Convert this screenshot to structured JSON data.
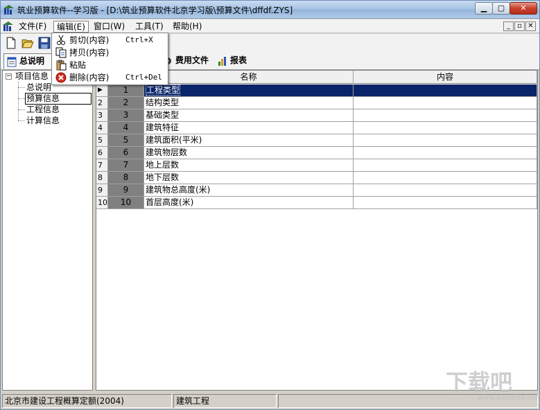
{
  "titlebar": {
    "title": "筑业预算软件--学习版 - [D:\\筑业预算软件北京学习版\\预算文件\\dffdf.ZYS]",
    "minimize_label": "▁",
    "maximize_label": "▢",
    "close_label": "✕"
  },
  "menubar": {
    "items": [
      {
        "label": "文件(F)"
      },
      {
        "label": "编辑(E)"
      },
      {
        "label": "窗口(W)"
      },
      {
        "label": "工具(T)"
      },
      {
        "label": "帮助(H)"
      }
    ],
    "mdi_controls": [
      "_",
      "▫",
      "✕"
    ]
  },
  "edit_menu": {
    "items": [
      {
        "label": "剪切(内容)",
        "shortcut": "Ctrl+X",
        "icon": "scissors-icon"
      },
      {
        "label": "拷贝(内容)",
        "shortcut": "",
        "icon": "copy-icon"
      },
      {
        "label": "粘贴",
        "shortcut": "",
        "icon": "paste-icon"
      },
      {
        "label": "删除(内容)",
        "shortcut": "Ctrl+Del",
        "icon": "delete-icon"
      }
    ]
  },
  "tabs": [
    {
      "label": "总说明",
      "icon": "document-icon"
    },
    {
      "label": "费用文件",
      "icon": "gear-icon"
    },
    {
      "label": "报表",
      "icon": "chart-icon"
    }
  ],
  "tree": {
    "root": "项目信息",
    "children": [
      "总说明",
      "预算信息",
      "工程信息",
      "计算信息"
    ],
    "selected": "预算信息"
  },
  "grid": {
    "headers": {
      "name": "名称",
      "content": "内容"
    },
    "rows": [
      {
        "n": "1",
        "idx": "1",
        "name": "工程类型",
        "content": ""
      },
      {
        "n": "2",
        "idx": "2",
        "name": "结构类型",
        "content": ""
      },
      {
        "n": "3",
        "idx": "3",
        "name": "基础类型",
        "content": ""
      },
      {
        "n": "4",
        "idx": "4",
        "name": "建筑特征",
        "content": ""
      },
      {
        "n": "5",
        "idx": "5",
        "name": "建筑面积(平米)",
        "content": ""
      },
      {
        "n": "6",
        "idx": "6",
        "name": "建筑物层数",
        "content": ""
      },
      {
        "n": "7",
        "idx": "7",
        "name": "地上层数",
        "content": ""
      },
      {
        "n": "8",
        "idx": "8",
        "name": "地下层数",
        "content": ""
      },
      {
        "n": "9",
        "idx": "9",
        "name": "建筑物总高度(米)",
        "content": ""
      },
      {
        "n": "10",
        "idx": "10",
        "name": "首层高度(米)",
        "content": ""
      }
    ]
  },
  "statusbar": {
    "quota": "北京市建设工程概算定额(2004)",
    "project_type": "建筑工程",
    "extra": ""
  },
  "watermark": {
    "text": "下载吧",
    "url": "www.xiazaiba.com"
  },
  "colors": {
    "selection": "#0a246a",
    "index_cell": "#808080",
    "close_button": "#c7402b"
  }
}
